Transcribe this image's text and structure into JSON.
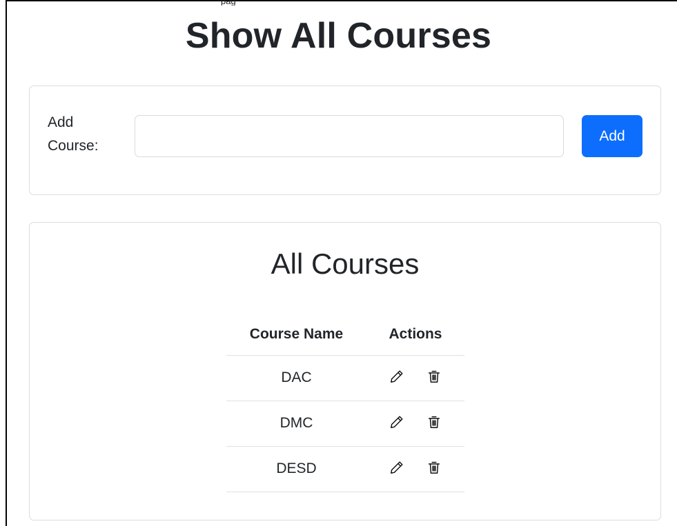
{
  "page": {
    "title": "Show All Courses",
    "tab_fragment": "pag"
  },
  "add_form": {
    "label": "Add Course:",
    "input_value": "",
    "input_placeholder": "",
    "button_label": "Add"
  },
  "course_list": {
    "title": "All Courses",
    "columns": [
      "Course Name",
      "Actions"
    ],
    "rows": [
      {
        "name": "DAC",
        "actions": [
          "edit-icon",
          "delete-icon"
        ]
      },
      {
        "name": "DMC",
        "actions": [
          "edit-icon",
          "delete-icon"
        ]
      },
      {
        "name": "DESD",
        "actions": [
          "edit-icon",
          "delete-icon"
        ]
      }
    ]
  },
  "colors": {
    "primary": "#0d6efd",
    "text": "#212529",
    "border": "#d9dce0"
  }
}
